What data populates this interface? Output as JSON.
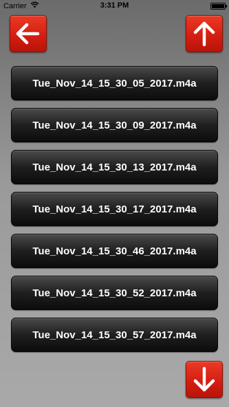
{
  "status_bar": {
    "carrier": "Carrier",
    "time": "3:31 PM",
    "battery_level": 1.0,
    "icons": [
      "wifi-icon",
      "battery-icon"
    ]
  },
  "toolbar": {
    "back_icon": "arrow-left-icon",
    "up_icon": "arrow-up-icon",
    "down_icon": "arrow-down-icon",
    "button_color": "#d8220f"
  },
  "files": [
    {
      "name": "Tue_Nov_14_15_30_05_2017.m4a"
    },
    {
      "name": "Tue_Nov_14_15_30_09_2017.m4a"
    },
    {
      "name": "Tue_Nov_14_15_30_13_2017.m4a"
    },
    {
      "name": "Tue_Nov_14_15_30_17_2017.m4a"
    },
    {
      "name": "Tue_Nov_14_15_30_46_2017.m4a"
    },
    {
      "name": "Tue_Nov_14_15_30_52_2017.m4a"
    },
    {
      "name": "Tue_Nov_14_15_30_57_2017.m4a"
    }
  ]
}
